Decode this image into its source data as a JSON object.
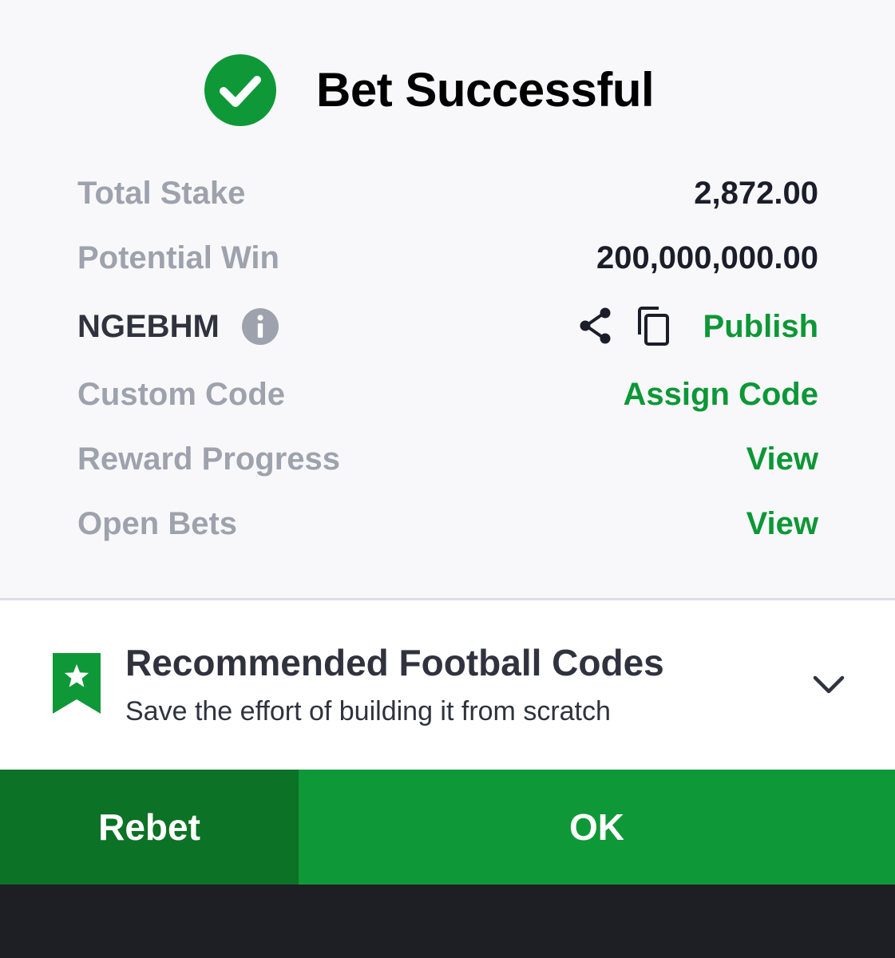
{
  "header": {
    "title": "Bet Successful"
  },
  "details": {
    "total_stake_label": "Total Stake",
    "total_stake_value": "2,872.00",
    "potential_win_label": "Potential Win",
    "potential_win_value": "200,000,000.00",
    "booking_code": "NGEBHM",
    "publish_label": "Publish",
    "custom_code_label": "Custom Code",
    "assign_code_label": "Assign Code",
    "reward_progress_label": "Reward Progress",
    "reward_progress_link": "View",
    "open_bets_label": "Open Bets",
    "open_bets_link": "View"
  },
  "recommended": {
    "title": "Recommended Football Codes",
    "subtitle": "Save the effort of building it from scratch"
  },
  "actions": {
    "rebet_label": "Rebet",
    "ok_label": "OK"
  },
  "colors": {
    "brand_green": "#0f9837",
    "dark_green": "#0c7225",
    "label_gray": "#9ea2ad",
    "text_dark": "#1b1e2a",
    "background": "#f8f8fa"
  },
  "icons": {
    "success": "check-circle-icon",
    "info": "info-icon",
    "share": "share-icon",
    "copy": "copy-icon",
    "bookmark": "bookmark-star-icon",
    "chevron": "chevron-down-icon"
  }
}
